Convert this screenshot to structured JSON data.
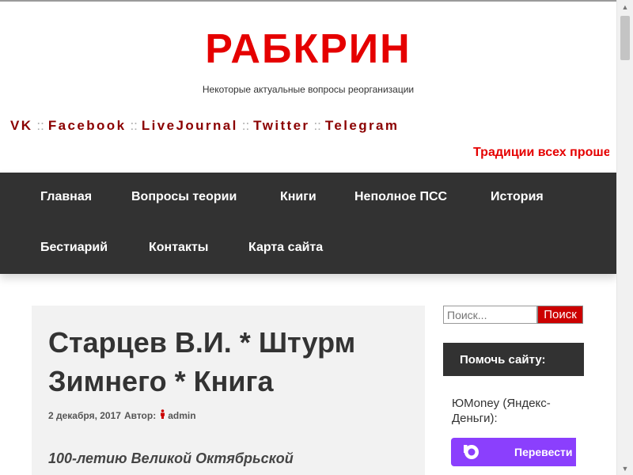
{
  "header": {
    "site_title": "РАБКРИН",
    "site_description": "Некоторые актуальные вопросы реорганизации"
  },
  "social": {
    "links": [
      "VK",
      "Facebook",
      "LiveJournal",
      "Twitter",
      "Telegram"
    ],
    "separator": "::"
  },
  "marquee": {
    "text": "Традиции всех проше"
  },
  "nav": {
    "items": [
      "Главная",
      "Вопросы теории",
      "Книги",
      "Неполное ПСС",
      "История",
      "Бестиарий",
      "Контакты",
      "Карта сайта"
    ]
  },
  "post": {
    "title": "Старцев В.И. * Штурм Зимнего * Книга",
    "date": "2 декабря, 2017",
    "author_label": "Автор:",
    "author": "admin",
    "excerpt": "100-летию Великой Октябрьской"
  },
  "sidebar": {
    "search_placeholder": "Поиск...",
    "search_button": "Поиск",
    "widget_title": "Помочь сайту:",
    "money_label": "ЮMoney (Яндекс-Деньги):",
    "pay_button": "Перевести"
  },
  "colors": {
    "title_red": "#e50000",
    "social_red": "#8b0000",
    "nav_bg": "#323232",
    "pay_purple": "#8b3ffd"
  }
}
